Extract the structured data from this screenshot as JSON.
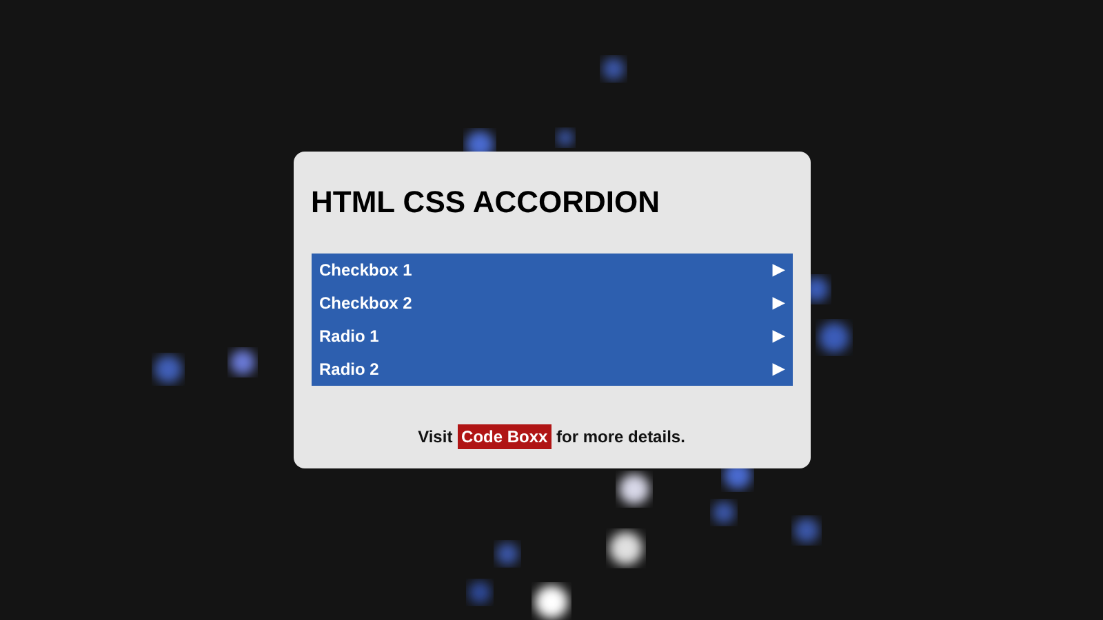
{
  "title": "HTML CSS ACCORDION",
  "accordion": [
    {
      "label": "Checkbox 1",
      "toggle": "▶",
      "expanded": false
    },
    {
      "label": "Checkbox 2",
      "toggle": "▶",
      "expanded": false
    },
    {
      "label": "Radio 1",
      "toggle": "▶",
      "expanded": false
    },
    {
      "label": "Radio 2",
      "toggle": "▶",
      "expanded": false
    }
  ],
  "footer": {
    "before": "Visit",
    "link": "Code Boxx",
    "after": "for more details."
  }
}
